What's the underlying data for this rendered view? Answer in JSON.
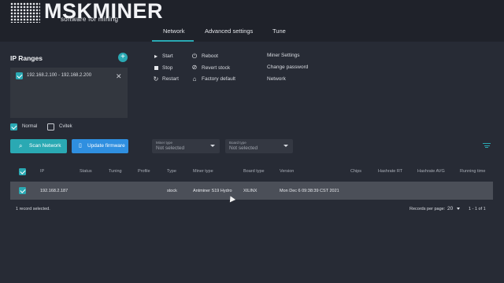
{
  "app": {
    "logo_text": "MSKMINER",
    "logo_sub": "software for mining"
  },
  "tabs": [
    {
      "label": "Network",
      "active": true
    },
    {
      "label": "Advanced settings",
      "active": false
    },
    {
      "label": "Tune",
      "active": false
    }
  ],
  "ip_ranges": {
    "title": "IP Ranges",
    "add_icon": "plus-icon",
    "items": [
      {
        "label": "192.168.2.100 - 192.168.2.200",
        "checked": true
      }
    ]
  },
  "modes": [
    {
      "label": "Normal",
      "checked": true
    },
    {
      "label": "Cvitek",
      "checked": false
    }
  ],
  "actions": {
    "col1": [
      {
        "label": "Start",
        "icon": "play-icon"
      },
      {
        "label": "Stop",
        "icon": "stop-icon"
      },
      {
        "label": "Restart",
        "icon": "restart-icon"
      }
    ],
    "col2": [
      {
        "label": "Reboot",
        "icon": "power-icon"
      },
      {
        "label": "Revert stock",
        "icon": "revert-icon"
      },
      {
        "label": "Factory default",
        "icon": "factory-icon"
      }
    ],
    "col3": [
      {
        "label": "Miner Settings"
      },
      {
        "label": "Change password"
      },
      {
        "label": "Network"
      }
    ]
  },
  "buttons": {
    "scan": "Scan Network",
    "update": "Update firmware"
  },
  "filters": [
    {
      "label": "Miner type",
      "placeholder": "Not selected"
    },
    {
      "label": "Board type",
      "placeholder": "Not selected"
    }
  ],
  "table": {
    "columns": [
      "IP",
      "Status",
      "Tuning",
      "Profile",
      "Type",
      "Miner type",
      "Board type",
      "Version",
      "Chips",
      "Hashrate RT",
      "Hashrate AVG",
      "Running time"
    ],
    "rows": [
      {
        "checked": true,
        "IP": "192.168.2.187",
        "Status": "",
        "Tuning": "",
        "Profile": "",
        "Type": "stock",
        "Miner type": "Antminer S19 Hydro",
        "Board type": "XILINX",
        "Version": "Mon Dec 6 09:38:39 CST 2021",
        "Chips": "",
        "Hashrate RT": "",
        "Hashrate AVG": "",
        "Running time": ""
      }
    ]
  },
  "footer": {
    "selected": "1 record selected.",
    "rpp_label": "Records per page:",
    "rpp_value": "20",
    "range": "1 - 1 of 1"
  },
  "colors": {
    "accent": "#2aa9b3",
    "primary_button": "#2f8fe0",
    "background": "#272b35"
  }
}
